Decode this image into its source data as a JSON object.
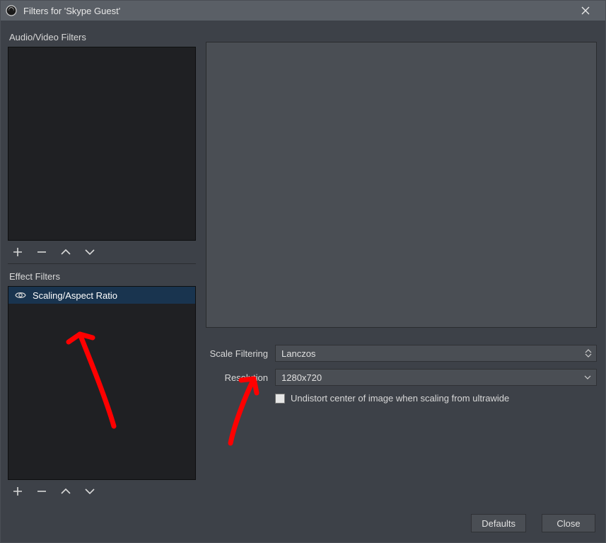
{
  "window": {
    "title": "Filters for 'Skype Guest'"
  },
  "left": {
    "av_label": "Audio/Video Filters",
    "effect_label": "Effect Filters",
    "effect_items": [
      {
        "name": "Scaling/Aspect Ratio"
      }
    ]
  },
  "props": {
    "scale_filtering_label": "Scale Filtering",
    "scale_filtering_value": "Lanczos",
    "resolution_label": "Resolution",
    "resolution_value": "1280x720",
    "undistort_label": "Undistort center of image when scaling from ultrawide",
    "undistort_checked": false
  },
  "footer": {
    "defaults_label": "Defaults",
    "close_label": "Close"
  }
}
